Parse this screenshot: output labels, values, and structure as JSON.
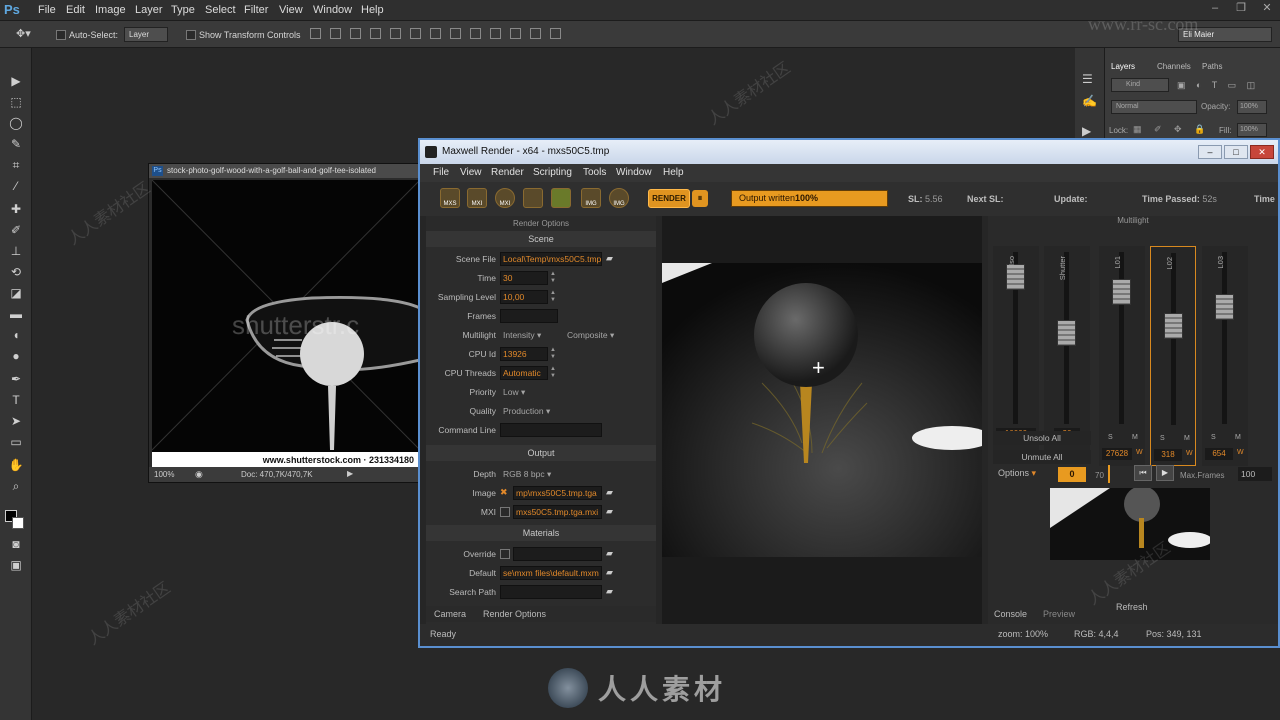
{
  "ps": {
    "logo": "Ps",
    "menu": [
      "File",
      "Edit",
      "Image",
      "Layer",
      "Type",
      "Select",
      "Filter",
      "View",
      "Window",
      "Help"
    ],
    "options": {
      "auto_select": "Auto-Select:",
      "layer_select": "Layer",
      "transform": "Show Transform Controls",
      "user": "Eli Maier"
    },
    "panel": {
      "tabs": [
        "Layers",
        "Channels",
        "Paths"
      ],
      "kind": "Kind",
      "blend": "Normal",
      "opacity": "Opacity:",
      "opacity_val": "100%",
      "lock": "Lock:",
      "fill": "Fill:",
      "fill_val": "100%"
    },
    "doc": {
      "title": "stock-photo-golf-wood-with-a-golf-ball-and-golf-tee-isolated",
      "zoom": "100%",
      "doc_size": "Doc: 470,7K/470,7K",
      "caption": "www.shutterstock.com · 231334180",
      "watermark": "shutterstr.c"
    }
  },
  "mx": {
    "title": "Maxwell Render  -  x64 - mxs50C5.tmp",
    "menu": [
      "File",
      "View",
      "Render",
      "Scripting",
      "Tools",
      "Window",
      "Help"
    ],
    "toolbar_icons": [
      "MXS",
      "MXI",
      "MXI",
      "",
      "",
      "IMG",
      "IMG"
    ],
    "render_label": "RENDER",
    "progress": "Output written",
    "progress_pct": "100%",
    "progress_value": 1.0,
    "stats": {
      "sl_label": "SL:",
      "sl": "5.56",
      "next_sl": "Next SL:",
      "update": "Update:",
      "time_passed": "Time Passed:",
      "time_passed_val": "52s",
      "time": "Time"
    },
    "render_options": {
      "header": "Render Options",
      "scene_head": "Scene",
      "scene_file_lbl": "Scene File",
      "scene_file": "Local\\Temp\\mxs50C5.tmp",
      "time_lbl": "Time",
      "time": "30",
      "sampling_lbl": "Sampling Level",
      "sampling": "10,00",
      "frames_lbl": "Frames",
      "multilight_lbl": "Multilight",
      "multilight": "Intensity",
      "multilight2": "Composite",
      "cpu_id_lbl": "CPU Id",
      "cpu_id": "13926",
      "cpu_threads_lbl": "CPU Threads",
      "cpu_threads": "Automatic",
      "priority_lbl": "Priority",
      "priority": "Low",
      "quality_lbl": "Quality",
      "quality": "Production",
      "cmd_lbl": "Command Line",
      "output_head": "Output",
      "depth_lbl": "Depth",
      "depth": "RGB  8 bpc",
      "image_lbl": "Image",
      "image": "mp\\mxs50C5.tmp.tga",
      "mxi_lbl": "MXI",
      "mxi": "mxs50C5.tmp.tga.mxi",
      "materials_head": "Materials",
      "override_lbl": "Override",
      "default_lbl": "Default",
      "default": "se\\mxm files\\default.mxm",
      "search_lbl": "Search Path"
    },
    "bottom_tabs": [
      "Camera",
      "Render Options"
    ],
    "multilight": {
      "header": "Multilight",
      "sliders": [
        {
          "label": "Iso",
          "value": "10000",
          "level": 0.92
        },
        {
          "label": "Shutter",
          "value": "20",
          "level": 0.55
        },
        {
          "label": "L01",
          "value": "27628",
          "unit": "W",
          "level": 0.82
        },
        {
          "label": "L02",
          "value": "318",
          "unit": "W",
          "level": 0.6
        },
        {
          "label": "L03",
          "value": "654",
          "unit": "W",
          "level": 0.72
        }
      ],
      "unsolo": "Unsolo All",
      "unmute": "Unmute All",
      "options": "Options",
      "frame": "0",
      "frame2": "70",
      "max_frames_lbl": "Max.Frames",
      "max_frames": "100",
      "console": "Console",
      "preview": "Preview",
      "refresh": "Refresh"
    },
    "status": {
      "ready": "Ready",
      "zoom": "zoom: 100%",
      "rgb": "RGB: 4,4,4",
      "pos": "Pos: 349, 131"
    }
  },
  "watermark": {
    "site": "www.rr-sc.com",
    "brand": "人人素材",
    "repeat": "人人素材社区"
  },
  "colors": {
    "accent": "#e89a20",
    "title_blue": "#5a8fd0"
  }
}
